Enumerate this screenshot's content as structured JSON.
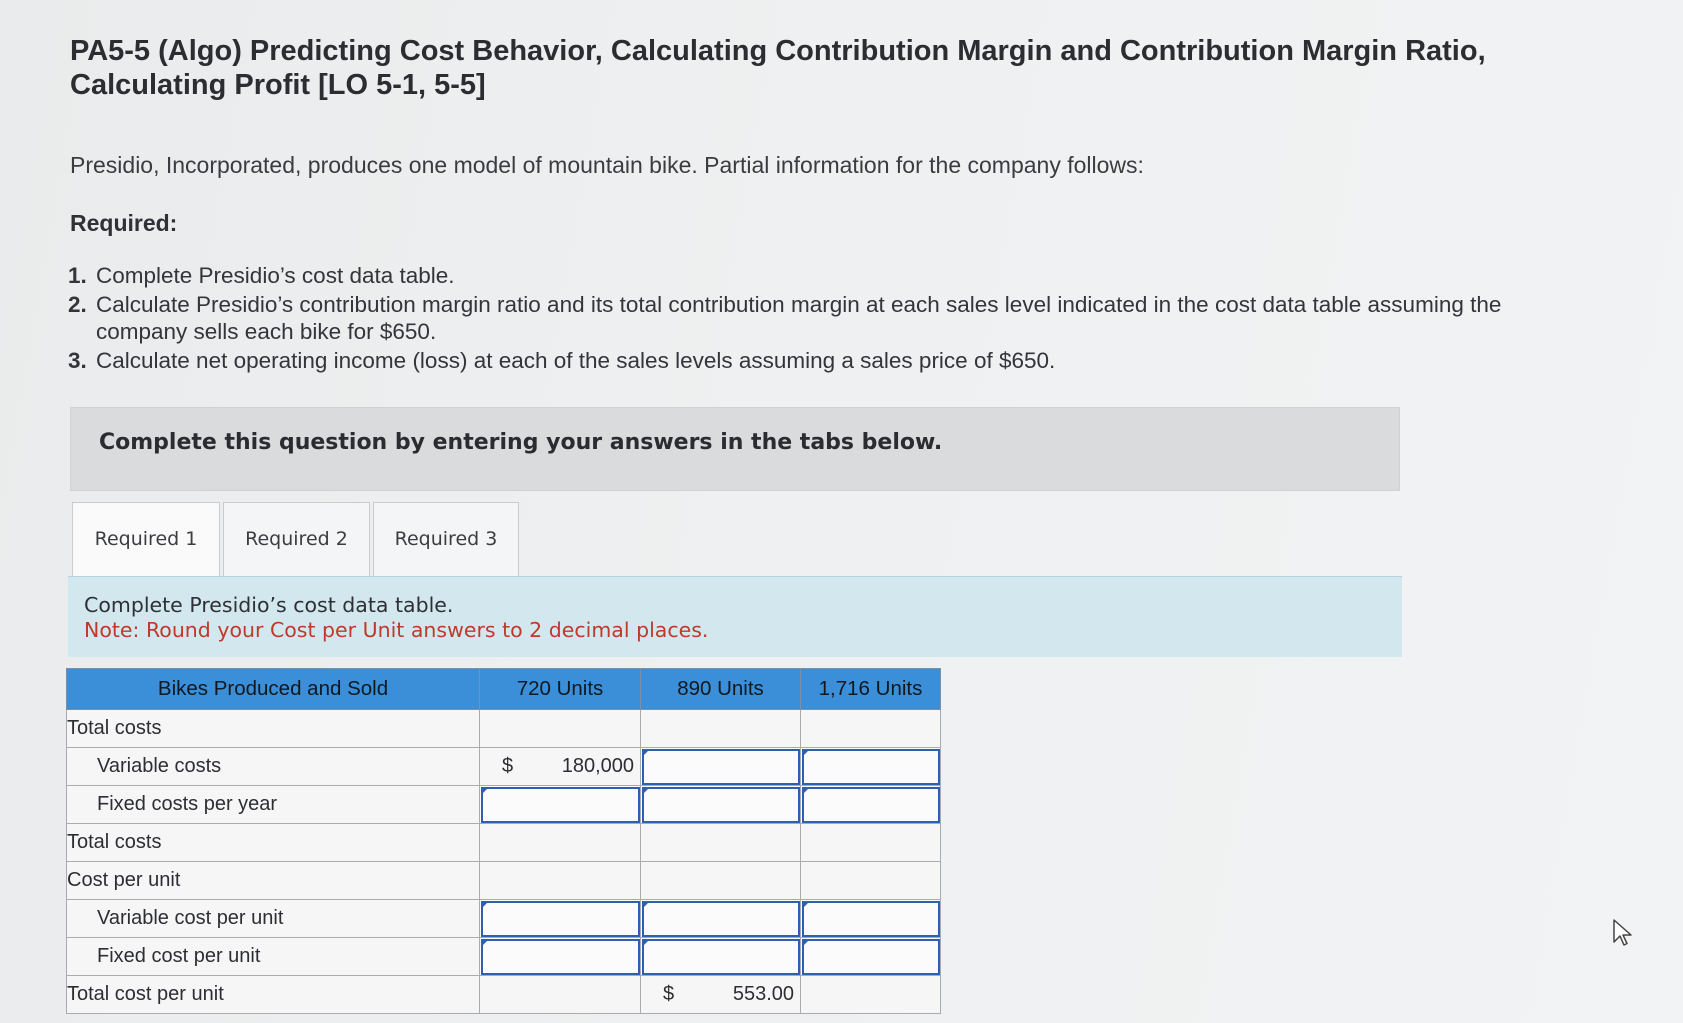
{
  "title": "PA5-5 (Algo) Predicting Cost Behavior, Calculating Contribution Margin and Contribution Margin Ratio, Calculating Profit [LO 5-1, 5-5]",
  "intro": "Presidio, Incorporated, produces one model of mountain bike. Partial information for the company follows:",
  "required_heading": "Required:",
  "requirements": [
    {
      "num": "1.",
      "text": "Complete Presidio’s cost data table."
    },
    {
      "num": "2.",
      "text": "Calculate Presidio’s contribution margin ratio and its total contribution margin at each sales level indicated in the cost data table assuming the company sells each bike for $650."
    },
    {
      "num": "3.",
      "text": "Calculate net operating income (loss) at each of the sales levels assuming a sales price of $650."
    }
  ],
  "banner": "Complete this question by entering your answers in the tabs below.",
  "tabs": [
    "Required 1",
    "Required 2",
    "Required 3"
  ],
  "instructions": {
    "line1": "Complete Presidio’s cost data table.",
    "note": "Note: Round your Cost per Unit answers to 2 decimal places."
  },
  "table": {
    "headers": [
      "Bikes Produced and Sold",
      "720 Units",
      "890 Units",
      "1,716 Units"
    ],
    "rows": {
      "total_costs_heading": "Total costs",
      "variable_costs": "Variable costs",
      "fixed_costs": "Fixed costs per year",
      "total_costs": "Total costs",
      "cost_per_unit": "Cost per unit",
      "variable_cost_per_unit": "Variable cost per unit",
      "fixed_cost_per_unit": "Fixed cost per unit",
      "total_cost_per_unit": "Total cost per unit"
    },
    "variable_costs_720": {
      "symbol": "$",
      "value": "180,000"
    },
    "total_cost_per_unit_890": {
      "symbol": "$",
      "value": "553.00"
    }
  },
  "colors": {
    "header_blue": "#3a8fd8",
    "note_red": "#c0392b",
    "instruction_bg": "#d3e7ef",
    "input_border": "#2f5fb3"
  }
}
